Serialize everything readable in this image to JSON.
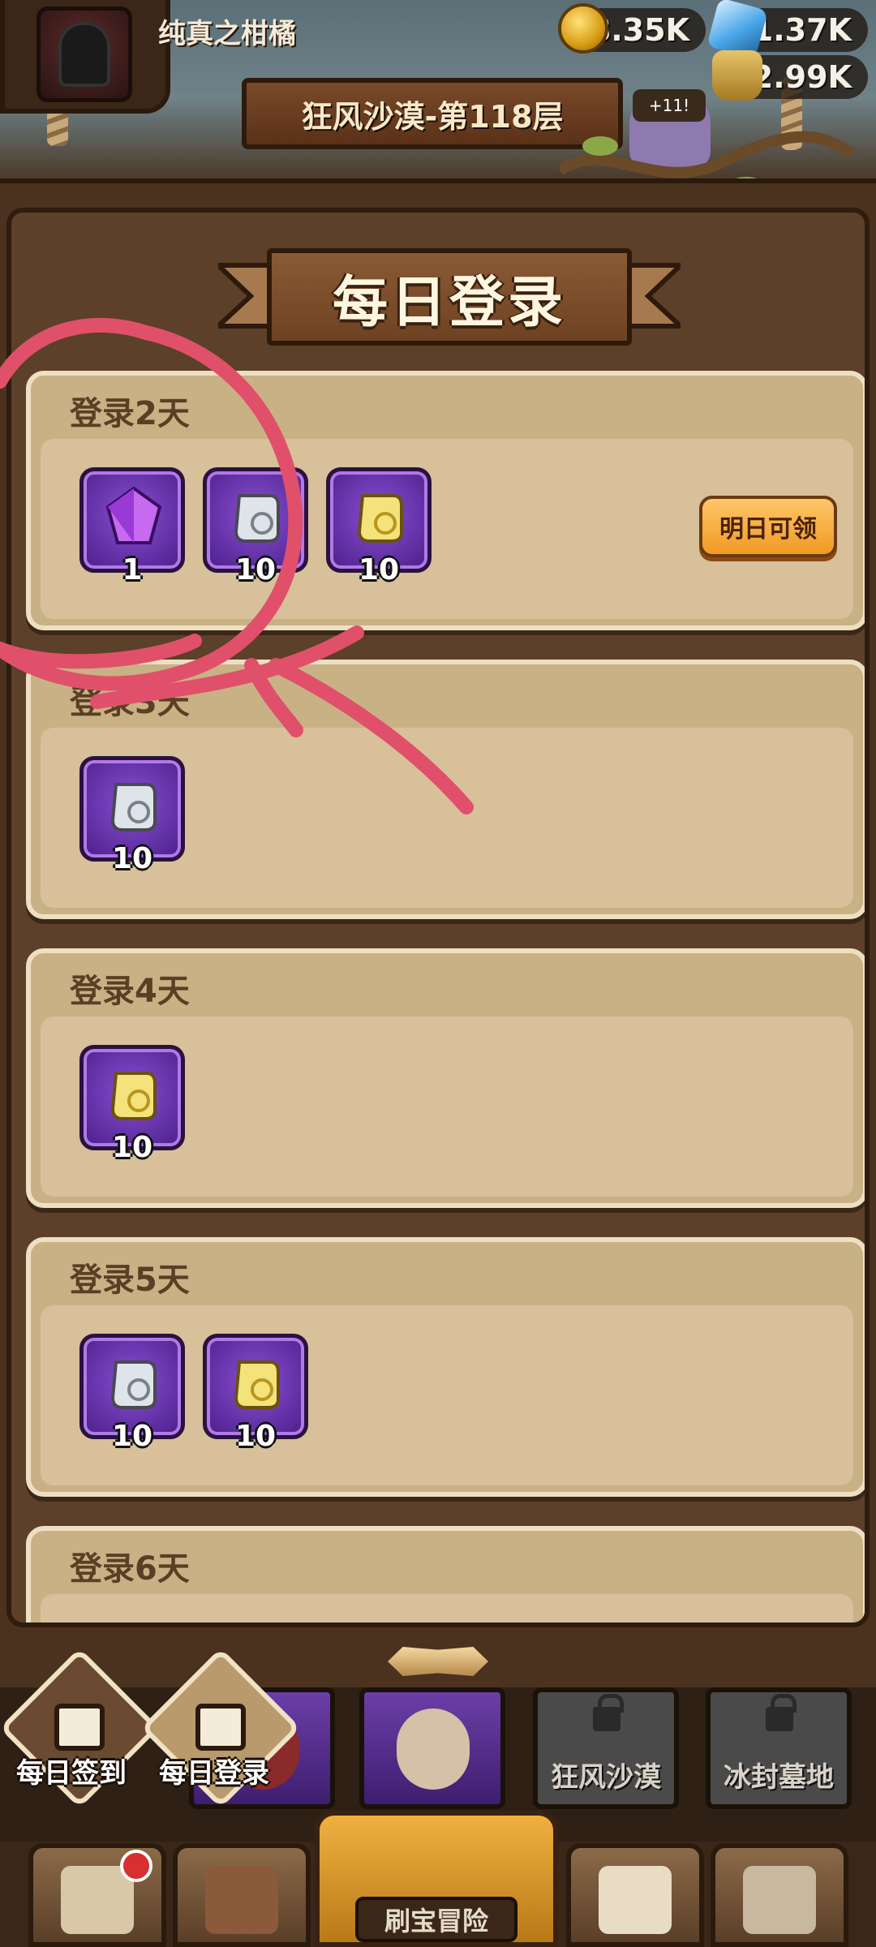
{
  "header": {
    "player_name": "纯真之柑橘",
    "coins": "8.35K",
    "gems": "1.37K",
    "potions": "2.99K",
    "stage": "狂风沙漠-第118层",
    "pet_badge": "+11!"
  },
  "panel": {
    "title": "每日登录",
    "days": [
      {
        "title": "登录2天",
        "items": [
          {
            "icon": "purple-crystal-icon",
            "qty": "1"
          },
          {
            "icon": "silver-scroll-icon",
            "qty": "10"
          },
          {
            "icon": "gold-scroll-icon",
            "qty": "10"
          }
        ],
        "button": "明日可领"
      },
      {
        "title": "登录3天",
        "items": [
          {
            "icon": "silver-scroll-icon",
            "qty": "10"
          }
        ]
      },
      {
        "title": "登录4天",
        "items": [
          {
            "icon": "gold-scroll-icon",
            "qty": "10"
          }
        ]
      },
      {
        "title": "登录5天",
        "items": [
          {
            "icon": "silver-scroll-icon",
            "qty": "10"
          },
          {
            "icon": "gold-scroll-icon",
            "qty": "10"
          }
        ]
      },
      {
        "title": "登录6天",
        "items": []
      }
    ]
  },
  "sub_tabs": {
    "daily_checkin": "每日签到",
    "daily_login": "每日登录",
    "windy_desert": "狂风沙漠",
    "frozen_tomb": "冰封墓地"
  },
  "bottom_nav": {
    "treasure_adventure": "刷宝冒险"
  },
  "colors": {
    "card_bg": "#c9b186",
    "item_bg": "#6b3ea8",
    "button_orange": "#f09a22",
    "annotation_red": "#e0506a"
  }
}
